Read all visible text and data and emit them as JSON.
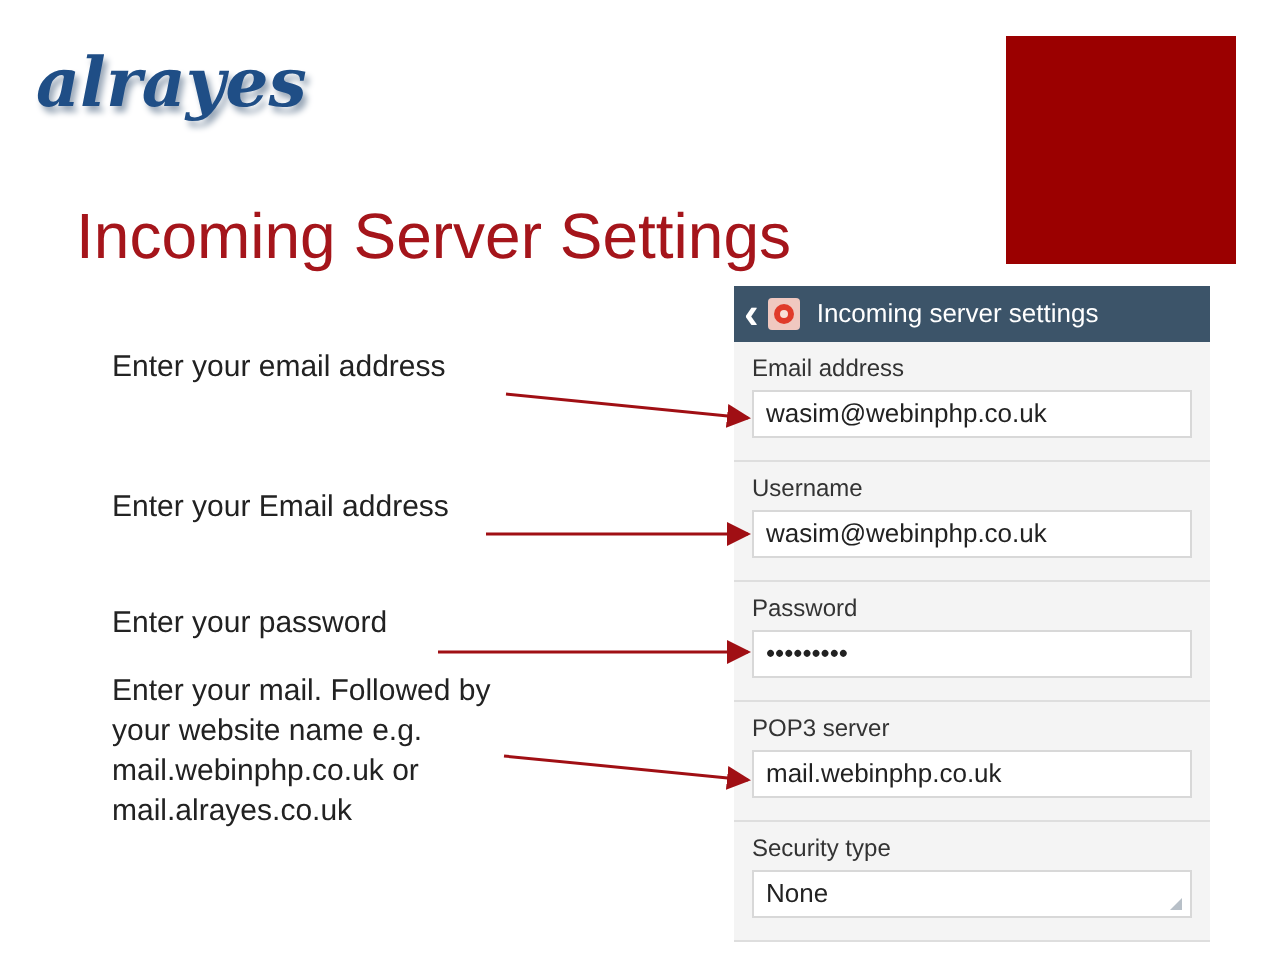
{
  "logo": {
    "text": "alrayes"
  },
  "title": "Incoming Server Settings",
  "notes": [
    "Enter your email address",
    "Enter your Email address",
    "Enter your password",
    "Enter your mail. Followed by your website name e.g. mail.webinphp.co.uk or mail.alrayes.co.uk"
  ],
  "phone": {
    "header": {
      "back": "‹",
      "title": "Incoming server settings"
    },
    "fields": [
      {
        "kind": "text",
        "label": "Email address",
        "value": "wasim@webinphp.co.uk"
      },
      {
        "kind": "text",
        "label": "Username",
        "value": "wasim@webinphp.co.uk"
      },
      {
        "kind": "password",
        "label": "Password",
        "value": "•••••••••"
      },
      {
        "kind": "text",
        "label": "POP3 server",
        "value": "mail.webinphp.co.uk"
      },
      {
        "kind": "select",
        "label": "Security type",
        "value": "None"
      }
    ]
  }
}
